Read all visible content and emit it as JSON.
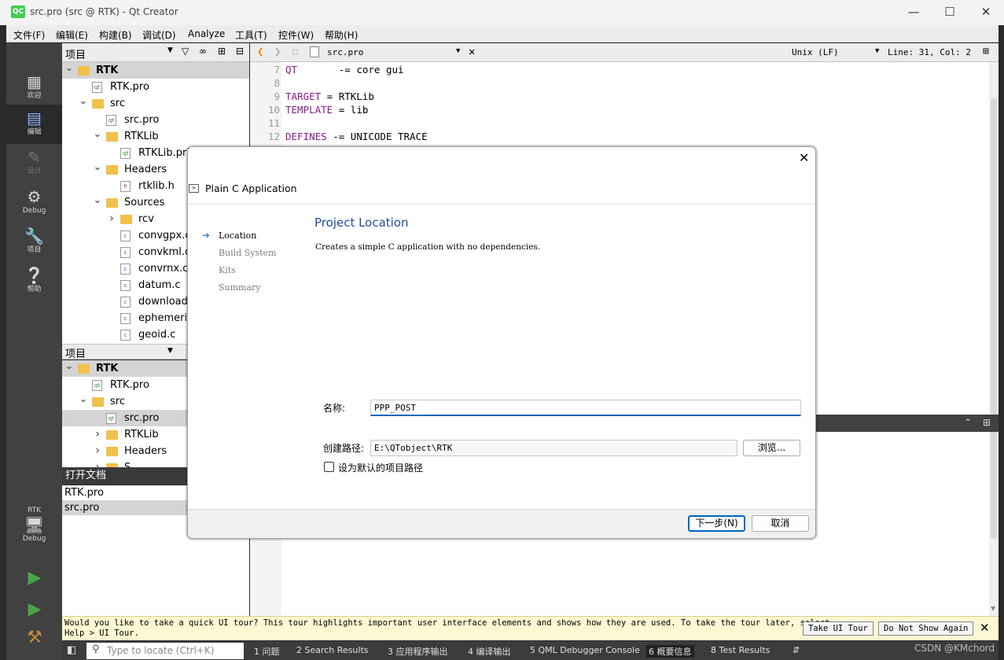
{
  "window": {
    "title": "src.pro (src @ RTK) - Qt Creator",
    "app_icon": "QC"
  },
  "menu": [
    "文件(F)",
    "编辑(E)",
    "构建(B)",
    "调试(D)",
    "Analyze",
    "工具(T)",
    "控件(W)",
    "帮助(H)"
  ],
  "modes": [
    {
      "label": "欢迎",
      "icon": "grid-icon"
    },
    {
      "label": "编辑",
      "icon": "document-icon"
    },
    {
      "label": "设计",
      "icon": "pencil-icon"
    },
    {
      "label": "Debug",
      "icon": "bug-icon"
    },
    {
      "label": "项目",
      "icon": "wrench-icon"
    },
    {
      "label": "帮助",
      "icon": "help-icon"
    }
  ],
  "kit": {
    "project": "RTK",
    "build": "Debug"
  },
  "projects_pane": {
    "title": "项目",
    "tree": [
      {
        "label": "RTK",
        "level": 0,
        "type": "pro-root",
        "expanded": true,
        "bold": true
      },
      {
        "label": "RTK.pro",
        "level": 1,
        "type": "pro"
      },
      {
        "label": "src",
        "level": 1,
        "type": "folder",
        "expanded": true
      },
      {
        "label": "src.pro",
        "level": 2,
        "type": "pro"
      },
      {
        "label": "RTKLib",
        "level": 2,
        "type": "folder",
        "expanded": true
      },
      {
        "label": "RTKLib.pri",
        "level": 3,
        "type": "pro"
      },
      {
        "label": "Headers",
        "level": 2,
        "type": "folder-h",
        "expanded": true
      },
      {
        "label": "rtklib.h",
        "level": 3,
        "type": "h"
      },
      {
        "label": "Sources",
        "level": 2,
        "type": "folder-c",
        "expanded": true
      },
      {
        "label": "rcv",
        "level": 3,
        "type": "folder",
        "collapsed": true
      },
      {
        "label": "convgpx.c",
        "level": 3,
        "type": "c"
      },
      {
        "label": "convkml.c",
        "level": 3,
        "type": "c"
      },
      {
        "label": "convrnx.c",
        "level": 3,
        "type": "c"
      },
      {
        "label": "datum.c",
        "level": 3,
        "type": "c"
      },
      {
        "label": "download.c",
        "level": 3,
        "type": "c"
      },
      {
        "label": "ephemeris.c",
        "level": 3,
        "type": "c"
      },
      {
        "label": "geoid.c",
        "level": 3,
        "type": "c"
      }
    ]
  },
  "projects_pane2": {
    "title": "项目",
    "tree": [
      {
        "label": "RTK",
        "level": 0,
        "type": "pro-root",
        "expanded": true,
        "bold": true
      },
      {
        "label": "RTK.pro",
        "level": 1,
        "type": "pro"
      },
      {
        "label": "src",
        "level": 1,
        "type": "folder",
        "expanded": true
      },
      {
        "label": "src.pro",
        "level": 2,
        "type": "pro",
        "selected": true
      },
      {
        "label": "RTKLib",
        "level": 2,
        "type": "folder",
        "collapsed": true
      },
      {
        "label": "Headers",
        "level": 2,
        "type": "folder-h",
        "collapsed": true
      },
      {
        "label": "S",
        "level": 2,
        "type": "folder-c",
        "collapsed": true
      }
    ]
  },
  "open_docs": {
    "title": "打开文档",
    "items": [
      "RTK.pro",
      "src.pro"
    ],
    "selected": 1
  },
  "editor": {
    "file": "src.pro",
    "line_ending": "Unix (LF)",
    "cursor": "Line: 31, Col: 2",
    "lines": [
      {
        "n": "7",
        "key": "QT",
        "rest": "       -= core gui"
      },
      {
        "n": "8",
        "key": "",
        "rest": ""
      },
      {
        "n": "9",
        "key": "TARGET",
        "rest": " = RTKLib"
      },
      {
        "n": "10",
        "key": "TEMPLATE",
        "rest": " = lib"
      },
      {
        "n": "11",
        "key": "",
        "rest": ""
      },
      {
        "n": "12",
        "key": "DEFINES",
        "rest": " -= UNICODE TRACE"
      }
    ]
  },
  "dialog": {
    "header": "Plain C Application",
    "steps": [
      "Location",
      "Build System",
      "Kits",
      "Summary"
    ],
    "active_step": 0,
    "page_title": "Project Location",
    "description": "Creates a simple C application with no dependencies.",
    "name_label": "名称:",
    "name_value": "PPP_POST",
    "path_label": "创建路径:",
    "path_value": "E:\\QTobject\\RTK",
    "browse": "浏览...",
    "default_checkbox": "设为默认的项目路径",
    "next": "下一步(N)",
    "cancel": "取消"
  },
  "tour": {
    "line1": "Would you like to take a quick UI tour? This tour highlights important user interface elements and shows how they are used. To take the tour later, select",
    "line2": "Help > UI Tour.",
    "take": "Take UI Tour",
    "dont_show": "Do Not Show Again"
  },
  "statusbar": {
    "locate_placeholder": "Type to locate (Ctrl+K)",
    "tabs": [
      "1 问题",
      "2 Search Results",
      "3 应用程序输出",
      "4 编译输出",
      "5 QML Debugger Console",
      "6 概要信息",
      "8 Test Results"
    ],
    "watermark": "CSDN @KMchord"
  }
}
